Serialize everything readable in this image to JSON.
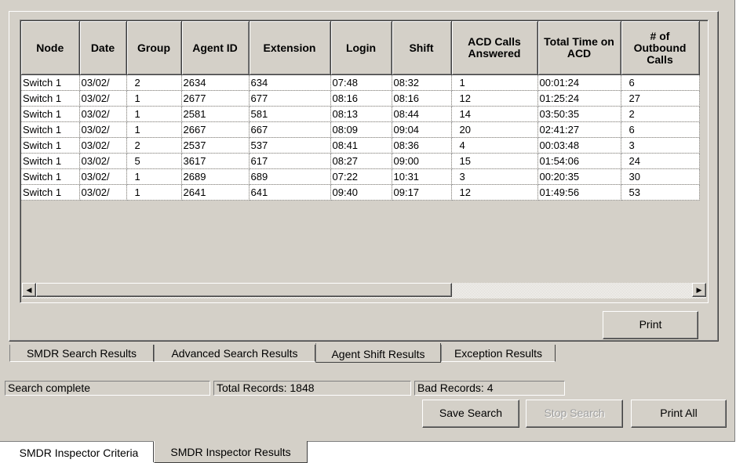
{
  "grid": {
    "columns": [
      "Node",
      "Date",
      "Group",
      "Agent ID",
      "Extension",
      "Login",
      "Shift",
      "ACD Calls Answered",
      "Total Time on ACD",
      "# of Outbound Calls"
    ],
    "rows": [
      [
        "Switch 1",
        "03/02/",
        "2",
        "2634",
        "634",
        "07:48",
        "08:32",
        "1",
        "00:01:24",
        "6"
      ],
      [
        "Switch 1",
        "03/02/",
        "1",
        "2677",
        "677",
        "08:16",
        "08:16",
        "12",
        "01:25:24",
        "27"
      ],
      [
        "Switch 1",
        "03/02/",
        "1",
        "2581",
        "581",
        "08:13",
        "08:44",
        "14",
        "03:50:35",
        "2"
      ],
      [
        "Switch 1",
        "03/02/",
        "1",
        "2667",
        "667",
        "08:09",
        "09:04",
        "20",
        "02:41:27",
        "6"
      ],
      [
        "Switch 1",
        "03/02/",
        "2",
        "2537",
        "537",
        "08:41",
        "08:36",
        "4",
        "00:03:48",
        "3"
      ],
      [
        "Switch 1",
        "03/02/",
        "5",
        "3617",
        "617",
        "08:27",
        "09:00",
        "15",
        "01:54:06",
        "24"
      ],
      [
        "Switch 1",
        "03/02/",
        "1",
        "2689",
        "689",
        "07:22",
        "10:31",
        "3",
        "00:20:35",
        "30"
      ],
      [
        "Switch 1",
        "03/02/",
        "1",
        "2641",
        "641",
        "09:40",
        "09:17",
        "12",
        "01:49:56",
        "53"
      ]
    ]
  },
  "scrollbar": {
    "left_arrow": "◀",
    "right_arrow": "▶"
  },
  "buttons": {
    "print": "Print",
    "save_search": "Save Search",
    "stop_search": "Stop Search",
    "print_all": "Print All"
  },
  "result_tabs": [
    "SMDR Search Results",
    "Advanced Search Results",
    "Agent Shift Results",
    "Exception Results"
  ],
  "status": {
    "message": "Search complete",
    "total_records": "Total Records: 1848",
    "bad_records": "Bad Records: 4"
  },
  "outer_tabs": [
    "SMDR Inspector Criteria",
    "SMDR Inspector Results"
  ]
}
